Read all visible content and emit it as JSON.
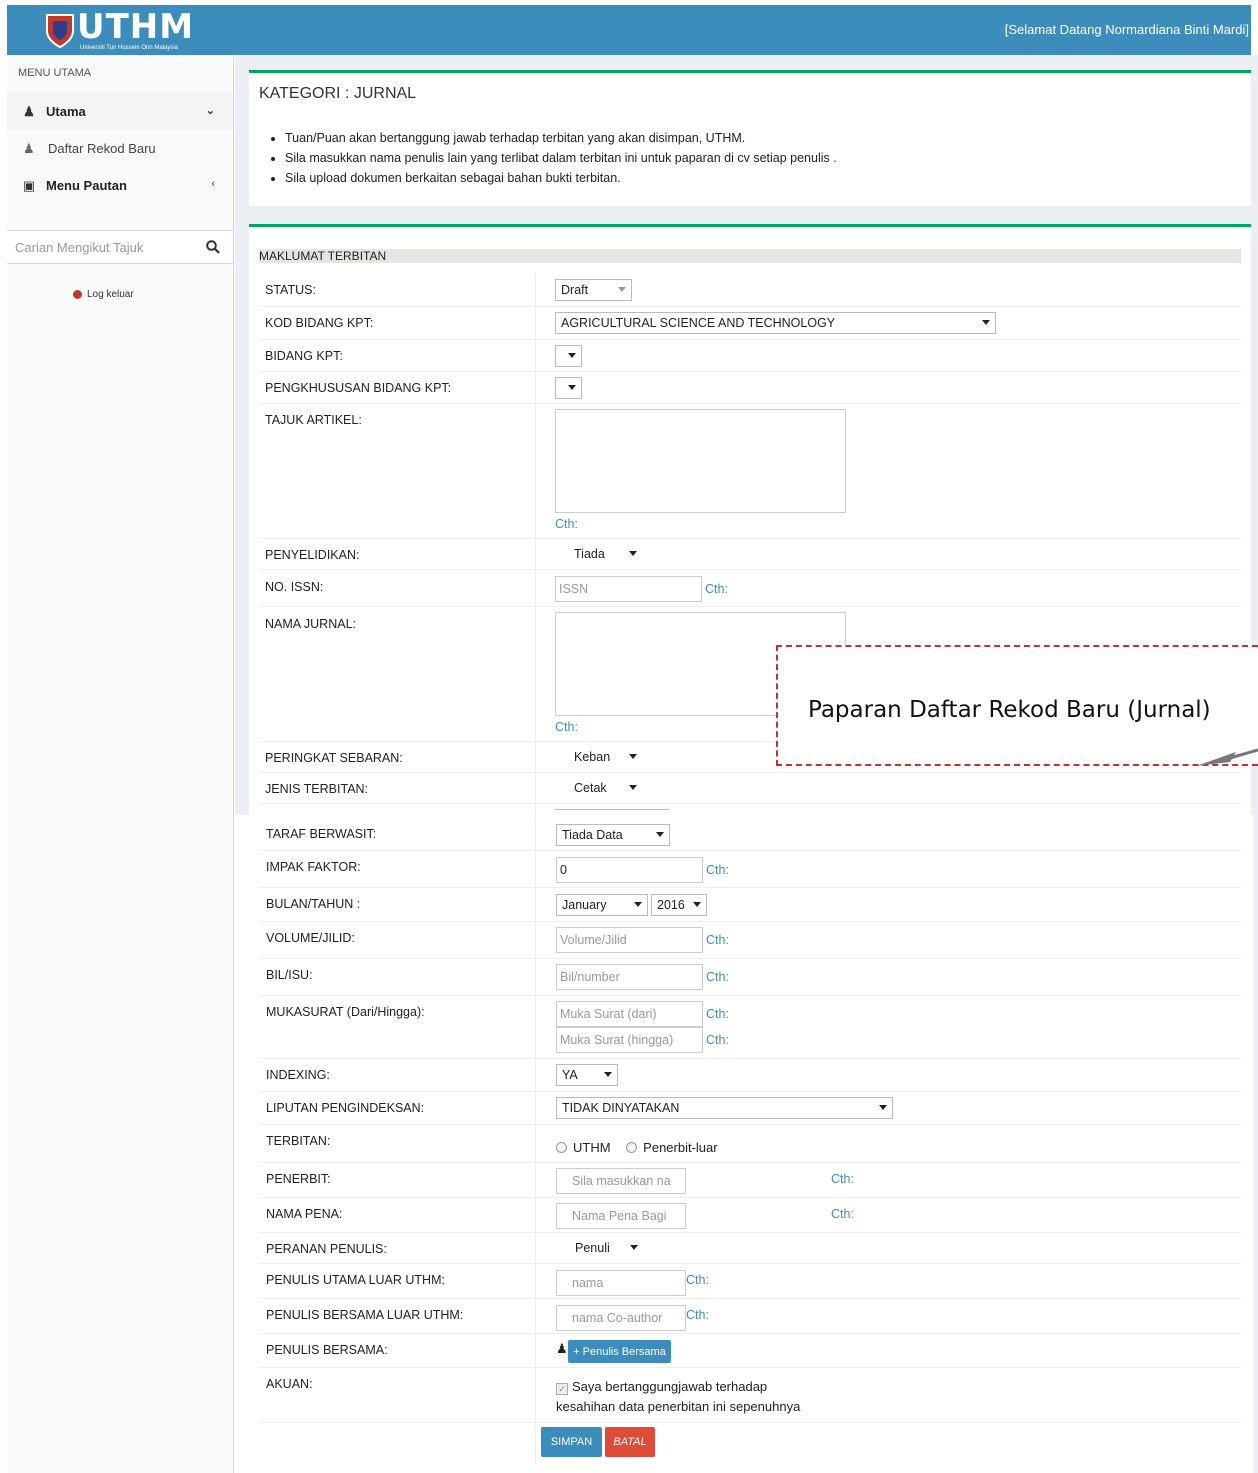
{
  "header": {
    "logo_text": "UTHM",
    "logo_sub": "Universiti Tun Hussein Onn Malaysia",
    "welcome": "[Selamat Datang Normardiana Binti Mardi]"
  },
  "sidebar": {
    "heading": "MENU UTAMA",
    "items": [
      {
        "label": "Utama"
      },
      {
        "label": "Daftar Rekod Baru"
      },
      {
        "label": "Menu Pautan"
      }
    ],
    "search_placeholder": "Carian Mengikut Tajuk",
    "logout": "Log keluar"
  },
  "info": {
    "title": "KATEGORI : JURNAL",
    "notes": [
      "Tuan/Puan akan bertanggung jawab terhadap terbitan yang akan disimpan, UTHM.",
      "Sila masukkan nama penulis lain yang terlibat dalam terbitan ini untuk paparan di cv setiap penulis .",
      "Sila upload dokumen berkaitan sebagai bahan bukti terbitan."
    ]
  },
  "form": {
    "section": "MAKLUMAT TERBITAN",
    "cth": "Cth:",
    "status": {
      "label": "STATUS:",
      "value": "Draft"
    },
    "kod_bidang": {
      "label": "KOD BIDANG KPT:",
      "value": "AGRICULTURAL SCIENCE AND TECHNOLOGY"
    },
    "bidang": {
      "label": "BIDANG KPT:"
    },
    "pengkhususan": {
      "label": "PENGKHUSUSAN BIDANG KPT:"
    },
    "tajuk": {
      "label": "TAJUK ARTIKEL:"
    },
    "penyelidikan": {
      "label": "PENYELIDIKAN:",
      "value": "Tiada"
    },
    "issn": {
      "label": "NO. ISSN:",
      "placeholder": "ISSN"
    },
    "nama_jurnal": {
      "label": "NAMA JURNAL:"
    },
    "peringkat": {
      "label": "PERINGKAT SEBARAN:",
      "value": "Keban"
    },
    "jenis": {
      "label": "JENIS TERBITAN:",
      "value": "Cetak"
    },
    "taraf": {
      "label": "TARAF BERWASIT:",
      "value": "Tiada Data"
    },
    "impak": {
      "label": "IMPAK FAKTOR:",
      "value": "0"
    },
    "bulan_tahun": {
      "label": "BULAN/TAHUN :",
      "month": "January",
      "year": "2016"
    },
    "volume": {
      "label": "VOLUME/JILID:",
      "placeholder": "Volume/Jilid"
    },
    "bil": {
      "label": "BIL/ISU:",
      "placeholder": "Bil/number"
    },
    "mukasurat": {
      "label": "MUKASURAT (Dari/Hingga):",
      "from_placeholder": "Muka Surat (dari)",
      "to_placeholder": "Muka Surat (hingga)"
    },
    "indexing": {
      "label": "INDEXING:",
      "value": "YA"
    },
    "liputan": {
      "label": "LIPUTAN PENGINDEKSAN:",
      "value": "TIDAK DINYATAKAN"
    },
    "terbitan": {
      "label": "TERBITAN:",
      "opt1": "UTHM",
      "opt2": "Penerbit-luar"
    },
    "penerbit": {
      "label": "PENERBIT:",
      "placeholder": "Sila masukkan na"
    },
    "nama_pena": {
      "label": "NAMA PENA:",
      "placeholder": "Nama Pena Bagi"
    },
    "peranan": {
      "label": "PERANAN PENULIS:",
      "value": "Penuli"
    },
    "penulis_utama": {
      "label": "PENULIS UTAMA LUAR UTHM:",
      "placeholder": "nama"
    },
    "penulis_bersama_luar": {
      "label": "PENULIS BERSAMA LUAR UTHM:",
      "placeholder": "nama Co-author"
    },
    "penulis_bersama": {
      "label": "PENULIS BERSAMA:",
      "button": "+ Penulis Bersama"
    },
    "akuan": {
      "label": "AKUAN:",
      "text1": "Saya bertanggungjawab terhadap",
      "text2": "kesahihan data penerbitan ini sepenuhnya"
    },
    "simpan": "SIMPAN",
    "batal": "BATAL"
  },
  "callout": "Paparan Daftar Rekod Baru (Jurnal)"
}
